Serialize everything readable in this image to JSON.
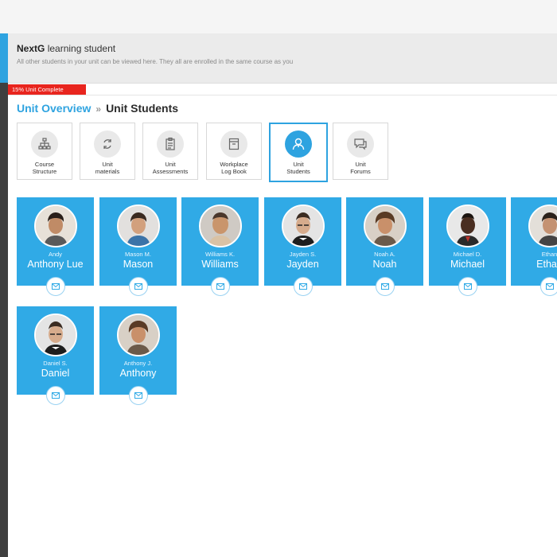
{
  "header": {
    "title_bold": "NextG",
    "title_rest": "learning student",
    "subtitle": "All other students in your unit can be viewed here. They all are enrolled in the same course as you"
  },
  "progress": {
    "label": "15% Unit Complete",
    "value_percent": 15
  },
  "breadcrumb": {
    "parent": "Unit Overview",
    "separator": "»",
    "current": "Unit Students"
  },
  "tiles": [
    {
      "line1": "Course",
      "line2": "Structure",
      "icon": "hierarchy-icon",
      "active": false
    },
    {
      "line1": "Unit",
      "line2": "materials",
      "icon": "recycle-icon",
      "active": false
    },
    {
      "line1": "Unit",
      "line2": "Assessments",
      "icon": "clipboard-icon",
      "active": false
    },
    {
      "line1": "Workplace",
      "line2": "Log Book",
      "icon": "logbook-icon",
      "active": false
    },
    {
      "line1": "Unit",
      "line2": "Students",
      "icon": "user-icon",
      "active": true
    },
    {
      "line1": "Unit",
      "line2": "Forums",
      "icon": "chat-icon",
      "active": false
    }
  ],
  "students": [
    {
      "short": "Andy",
      "name": "Anthony Lue"
    },
    {
      "short": "Mason M.",
      "name": "Mason"
    },
    {
      "short": "Williams K.",
      "name": "Williams"
    },
    {
      "short": "Jayden S.",
      "name": "Jayden"
    },
    {
      "short": "Noah A.",
      "name": "Noah"
    },
    {
      "short": "Michael D.",
      "name": "Michael"
    },
    {
      "short": "Ethan",
      "name": "Ethan"
    },
    {
      "short": "Daniel S.",
      "name": "Daniel"
    },
    {
      "short": "Anthony J.",
      "name": "Anthony"
    }
  ],
  "colors": {
    "accent": "#30aae6",
    "progress": "#e8251e",
    "sidebar": "#3f3f3f"
  }
}
